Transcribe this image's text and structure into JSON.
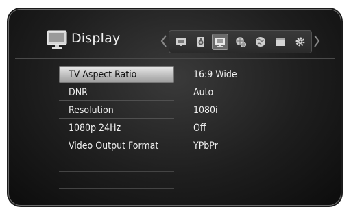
{
  "header": {
    "title": "Display",
    "icon": "display-monitor-icon"
  },
  "tabs": {
    "items": [
      {
        "name": "tab-monitor",
        "icon": "monitor-icon"
      },
      {
        "name": "tab-audio",
        "icon": "speaker-icon"
      },
      {
        "name": "tab-display",
        "icon": "display-icon",
        "selected": true
      },
      {
        "name": "tab-network",
        "icon": "globe-gear-icon"
      },
      {
        "name": "tab-language",
        "icon": "globe-icon"
      },
      {
        "name": "tab-lock",
        "icon": "folder-icon"
      },
      {
        "name": "tab-others",
        "icon": "gear-icon"
      }
    ]
  },
  "settings": [
    {
      "label": "TV Aspect Ratio",
      "value": "16:9 Wide",
      "selected": true
    },
    {
      "label": "DNR",
      "value": "Auto"
    },
    {
      "label": "Resolution",
      "value": "1080i"
    },
    {
      "label": "1080p 24Hz",
      "value": "Off"
    },
    {
      "label": "Video Output Format",
      "value": "YPbPr"
    }
  ],
  "colors": {
    "background": "#1e1e1e",
    "text": "#efefef",
    "highlight": "#d6d6d6"
  }
}
